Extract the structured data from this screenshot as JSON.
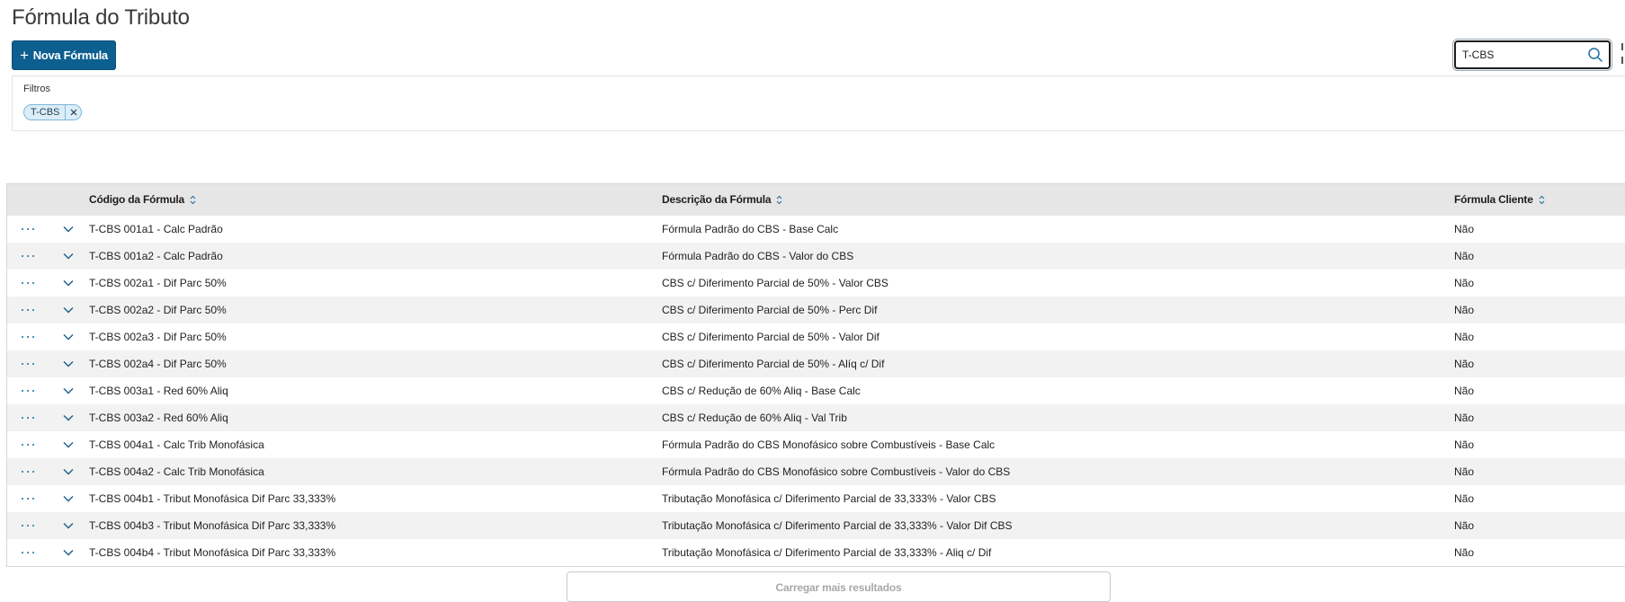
{
  "page": {
    "title": "Fórmula do Tributo"
  },
  "toolbar": {
    "new_button_label": "Nova Fórmula",
    "new_button_icon": "plus-icon"
  },
  "search": {
    "value": "T-CBS",
    "icon": "search-icon"
  },
  "filters": {
    "label": "Filtros",
    "chips": [
      {
        "label": "T-CBS"
      }
    ]
  },
  "table": {
    "columns": [
      {
        "label": "Código da Fórmula",
        "sortable": true
      },
      {
        "label": "Descrição da Fórmula",
        "sortable": true
      },
      {
        "label": "Fórmula Cliente",
        "sortable": true
      }
    ],
    "rows": [
      {
        "code": "T-CBS 001a1 - Calc Padrão",
        "description": "Fórmula Padrão do CBS - Base Calc",
        "client": "Não"
      },
      {
        "code": "T-CBS 001a2 - Calc Padrão",
        "description": "Fórmula Padrão do CBS - Valor do CBS",
        "client": "Não"
      },
      {
        "code": "T-CBS 002a1 - Dif Parc 50%",
        "description": "CBS c/ Diferimento Parcial de 50% - Valor CBS",
        "client": "Não"
      },
      {
        "code": "T-CBS 002a2 - Dif Parc 50%",
        "description": "CBS c/ Diferimento Parcial de 50% - Perc Dif",
        "client": "Não"
      },
      {
        "code": "T-CBS 002a3 - Dif Parc 50%",
        "description": "CBS c/ Diferimento Parcial de 50% - Valor Dif",
        "client": "Não"
      },
      {
        "code": "T-CBS 002a4 - Dif Parc 50%",
        "description": "CBS c/ Diferimento Parcial de 50% - Alíq c/ Dif",
        "client": "Não"
      },
      {
        "code": "T-CBS 003a1 - Red 60% Aliq",
        "description": "CBS c/ Redução de 60% Aliq - Base Calc",
        "client": "Não"
      },
      {
        "code": "T-CBS 003a2 - Red 60% Aliq",
        "description": "CBS c/ Redução de 60% Aliq - Val Trib",
        "client": "Não"
      },
      {
        "code": "T-CBS 004a1 - Calc Trib Monofásica",
        "description": "Fórmula Padrão do CBS Monofásico sobre Combustíveis - Base Calc",
        "client": "Não"
      },
      {
        "code": "T-CBS 004a2 - Calc Trib Monofásica",
        "description": "Fórmula Padrão do CBS Monofásico sobre Combustíveis - Valor do CBS",
        "client": "Não"
      },
      {
        "code": "T-CBS 004b1 - Tribut Monofásica Dif Parc 33,333%",
        "description": "Tributação Monofásica c/ Diferimento Parcial de 33,333% - Valor CBS",
        "client": "Não"
      },
      {
        "code": "T-CBS 004b3 - Tribut Monofásica Dif Parc 33,333%",
        "description": "Tributação Monofásica c/ Diferimento Parcial de 33,333% - Valor Dif CBS",
        "client": "Não"
      },
      {
        "code": "T-CBS 004b4 - Tribut Monofásica Dif Parc 33,333%",
        "description": "Tributação Monofásica c/ Diferimento Parcial de 33,333% - Aliq c/ Dif",
        "client": "Não"
      }
    ]
  },
  "footer": {
    "load_more_label": "Carregar mais resultados"
  },
  "colors": {
    "primary": "#0c5f8f",
    "link": "#1a6fa3",
    "header_bg": "#e6e6e6",
    "chip_bg": "#dcedf8"
  }
}
